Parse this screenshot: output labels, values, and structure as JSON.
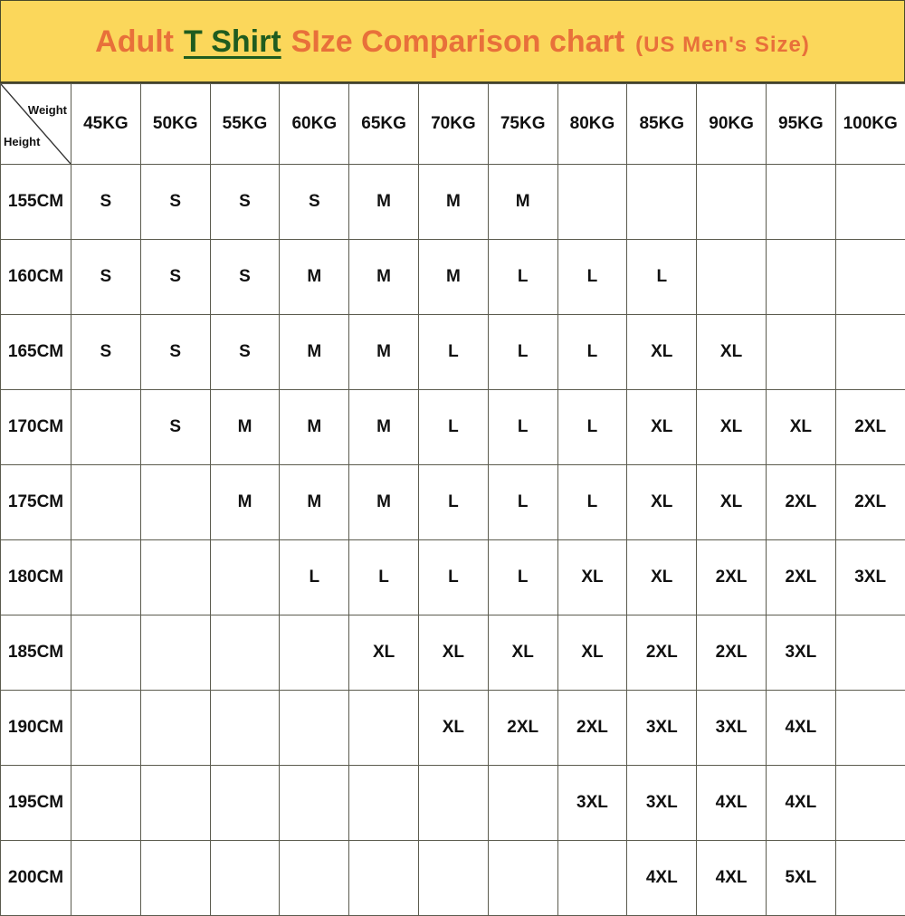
{
  "title": {
    "part1": "Adult",
    "part2": "T Shirt",
    "part3": "SIze Comparison chart",
    "suffix": "(US Men's Size)"
  },
  "corner": {
    "weight_label": "Weight",
    "height_label": "Height"
  },
  "colors": {
    "banner": "#FBD75B",
    "title_orange": "#E8703A",
    "title_green": "#1F5C1F",
    "S": "#F9DF8A",
    "M": "#A6CBE8",
    "L": "#2E78B8",
    "XL": "#7C7C7C",
    "2XL": "#4B8B2E",
    "3XL": "#C45A11",
    "4XL": "#F9DF8A",
    "5XL": "#FF0000",
    "empty": "#FFFFFF",
    "grid_line": "#5B5B4E"
  },
  "chart_data": {
    "type": "table",
    "title": "Adult T Shirt SIze Comparison chart (US Men's Size)",
    "xlabel": "Weight",
    "ylabel": "Height",
    "categories": [
      "45KG",
      "50KG",
      "55KG",
      "60KG",
      "65KG",
      "70KG",
      "75KG",
      "80KG",
      "85KG",
      "90KG",
      "95KG",
      "100KG"
    ],
    "row_labels": [
      "155CM",
      "160CM",
      "165CM",
      "170CM",
      "175CM",
      "180CM",
      "185CM",
      "190CM",
      "195CM",
      "200CM"
    ],
    "legend": [
      "S",
      "M",
      "L",
      "XL",
      "2XL",
      "3XL",
      "4XL",
      "5XL"
    ],
    "rows": [
      {
        "label": "155CM",
        "values": [
          "S",
          "S",
          "S",
          "S",
          "M",
          "M",
          "M",
          "",
          "",
          "",
          "",
          ""
        ]
      },
      {
        "label": "160CM",
        "values": [
          "S",
          "S",
          "S",
          "M",
          "M",
          "M",
          "L",
          "L",
          "L",
          "",
          "",
          ""
        ]
      },
      {
        "label": "165CM",
        "values": [
          "S",
          "S",
          "S",
          "M",
          "M",
          "L",
          "L",
          "L",
          "XL",
          "XL",
          "",
          ""
        ]
      },
      {
        "label": "170CM",
        "values": [
          "",
          "S",
          "M",
          "M",
          "M",
          "L",
          "L",
          "L",
          "XL",
          "XL",
          "XL",
          "2XL"
        ]
      },
      {
        "label": "175CM",
        "values": [
          "",
          "",
          "M",
          "M",
          "M",
          "L",
          "L",
          "L",
          "XL",
          "XL",
          "2XL",
          "2XL"
        ]
      },
      {
        "label": "180CM",
        "values": [
          "",
          "",
          "",
          "L",
          "L",
          "L",
          "L",
          "XL",
          "XL",
          "2XL",
          "2XL",
          "3XL"
        ]
      },
      {
        "label": "185CM",
        "values": [
          "",
          "",
          "",
          "",
          "XL",
          "XL",
          "XL",
          "XL",
          "2XL",
          "2XL",
          "3XL",
          ""
        ]
      },
      {
        "label": "190CM",
        "values": [
          "",
          "",
          "",
          "",
          "",
          "XL",
          "2XL",
          "2XL",
          "3XL",
          "3XL",
          "4XL",
          ""
        ]
      },
      {
        "label": "195CM",
        "values": [
          "",
          "",
          "",
          "",
          "",
          "",
          "",
          "3XL",
          "3XL",
          "4XL",
          "4XL",
          ""
        ]
      },
      {
        "label": "200CM",
        "values": [
          "",
          "",
          "",
          "",
          "",
          "",
          "",
          "",
          "4XL",
          "4XL",
          "5XL",
          ""
        ]
      }
    ]
  }
}
